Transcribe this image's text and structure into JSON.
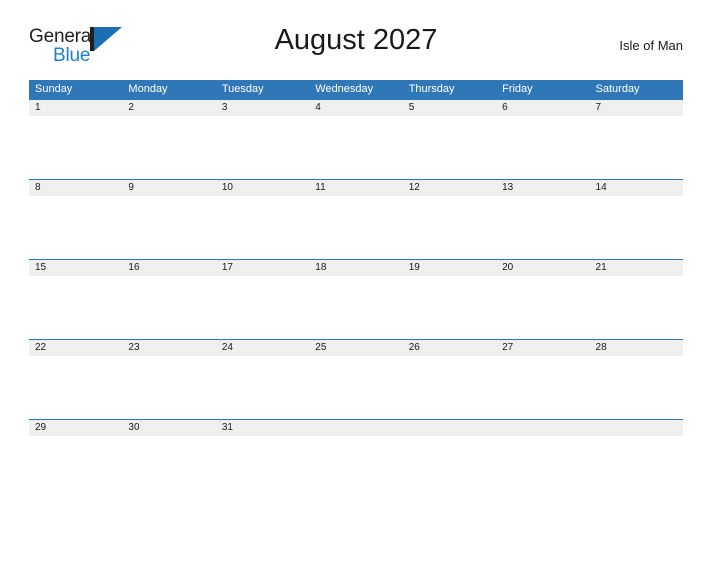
{
  "brand": {
    "name_part1": "General",
    "name_part2": "Blue",
    "mark": "triangle-flag-logo"
  },
  "header": {
    "title": "August 2027",
    "location": "Isle of Man"
  },
  "colors": {
    "header_blue": "#3077b8",
    "brand_blue": "#1b7fd4",
    "brand_mark_blue": "#1a6fb4",
    "date_band_gray": "#efefef",
    "text_dark": "#1a1a1a",
    "page_background": "#ffffff"
  },
  "calendar": {
    "weekdays": [
      "Sunday",
      "Monday",
      "Tuesday",
      "Wednesday",
      "Thursday",
      "Friday",
      "Saturday"
    ],
    "weeks": [
      [
        "1",
        "2",
        "3",
        "4",
        "5",
        "6",
        "7"
      ],
      [
        "8",
        "9",
        "10",
        "11",
        "12",
        "13",
        "14"
      ],
      [
        "15",
        "16",
        "17",
        "18",
        "19",
        "20",
        "21"
      ],
      [
        "22",
        "23",
        "24",
        "25",
        "26",
        "27",
        "28"
      ],
      [
        "29",
        "30",
        "31",
        "",
        "",
        "",
        ""
      ]
    ]
  }
}
